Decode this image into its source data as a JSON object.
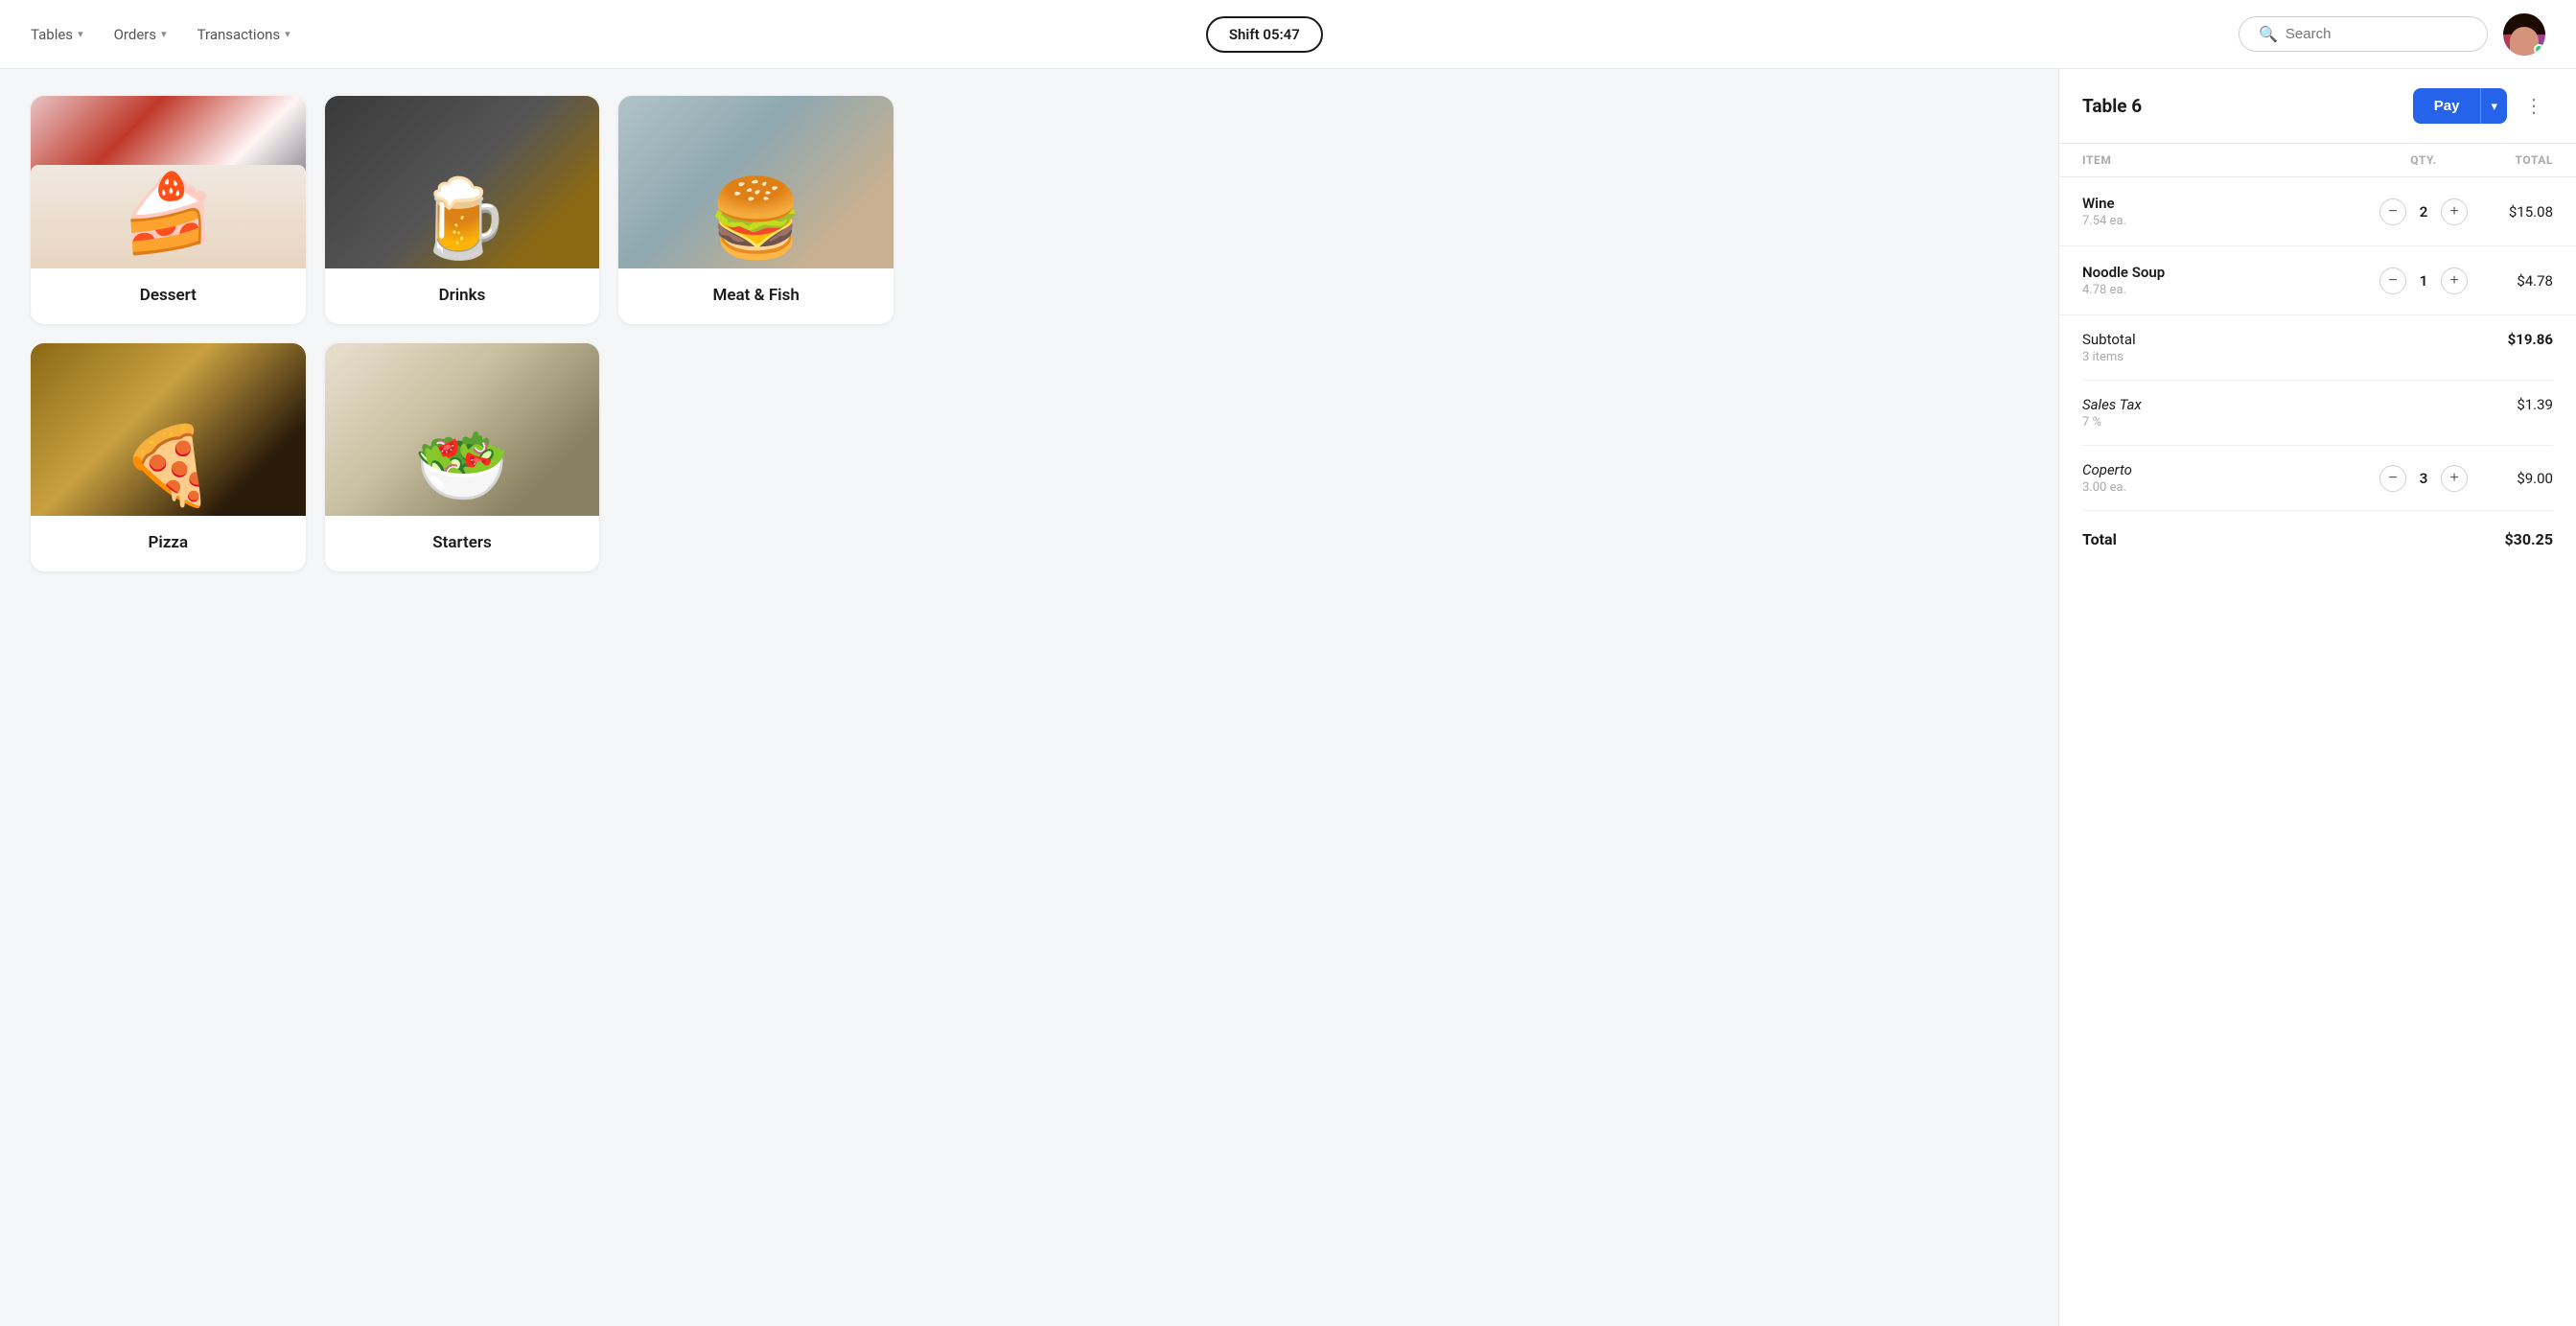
{
  "header": {
    "nav": [
      {
        "label": "Tables",
        "id": "tables"
      },
      {
        "label": "Orders",
        "id": "orders"
      },
      {
        "label": "Transactions",
        "id": "transactions"
      }
    ],
    "shift_label": "Shift 05:47",
    "search_placeholder": "Search"
  },
  "menu": {
    "categories": [
      {
        "id": "dessert",
        "label": "Dessert",
        "img_class": "img-dessert"
      },
      {
        "id": "drinks",
        "label": "Drinks",
        "img_class": "img-drinks"
      },
      {
        "id": "meat-fish",
        "label": "Meat & Fish",
        "img_class": "img-meat"
      },
      {
        "id": "pizza",
        "label": "Pizza",
        "img_class": "img-pizza"
      },
      {
        "id": "starters",
        "label": "Starters",
        "img_class": "img-starters"
      }
    ]
  },
  "order": {
    "table_title": "Table 6",
    "pay_label": "Pay",
    "columns": {
      "item": "ITEM",
      "qty": "QTY.",
      "total": "TOTAL"
    },
    "items": [
      {
        "name": "Wine",
        "price_ea": "7.54 ea.",
        "qty": 2,
        "total": "$15.08"
      },
      {
        "name": "Noodle Soup",
        "price_ea": "4.78 ea.",
        "qty": 1,
        "total": "$4.78"
      }
    ],
    "subtotal": {
      "label": "Subtotal",
      "sublabel": "3 items",
      "value": "$19.86"
    },
    "sales_tax": {
      "label": "Sales Tax",
      "sublabel": "7 %",
      "value": "$1.39"
    },
    "coperto": {
      "label": "Coperto",
      "price_ea": "3.00 ea.",
      "qty": 3,
      "total": "$9.00"
    },
    "total": {
      "label": "Total",
      "value": "$30.25"
    }
  }
}
